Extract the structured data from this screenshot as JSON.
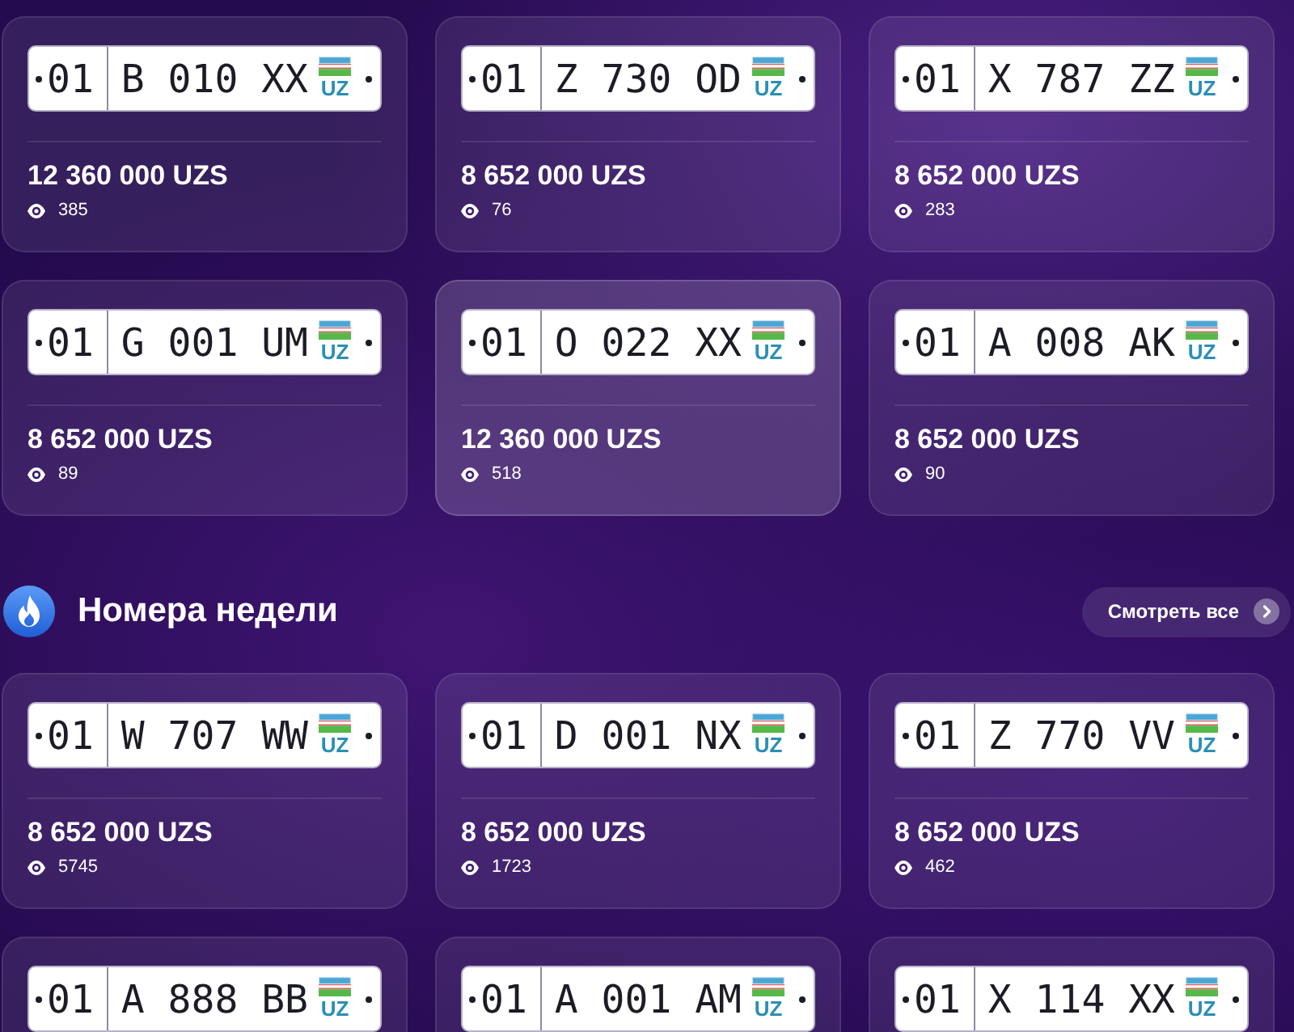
{
  "featured": {
    "cards": [
      {
        "plate": {
          "region": "01",
          "number": "B 010 XX",
          "country": "UZ"
        },
        "price": "12 360 000 UZS",
        "views": "385",
        "highlighted": false
      },
      {
        "plate": {
          "region": "01",
          "number": "Z 730 OD",
          "country": "UZ"
        },
        "price": "8 652 000 UZS",
        "views": "76",
        "highlighted": false
      },
      {
        "plate": {
          "region": "01",
          "number": "X 787 ZZ",
          "country": "UZ"
        },
        "price": "8 652 000 UZS",
        "views": "283",
        "highlighted": false
      },
      {
        "plate": {
          "region": "01",
          "number": "G 001 UM",
          "country": "UZ"
        },
        "price": "8 652 000 UZS",
        "views": "89",
        "highlighted": false
      },
      {
        "plate": {
          "region": "01",
          "number": "O 022 XX",
          "country": "UZ"
        },
        "price": "12 360 000 UZS",
        "views": "518",
        "highlighted": true
      },
      {
        "plate": {
          "region": "01",
          "number": "A 008 AK",
          "country": "UZ"
        },
        "price": "8 652 000 UZS",
        "views": "90",
        "highlighted": false
      }
    ]
  },
  "weekly": {
    "title": "Номера недели",
    "view_all": "Смотреть все",
    "cards": [
      {
        "plate": {
          "region": "01",
          "number": "W 707 WW",
          "country": "UZ"
        },
        "price": "8 652 000 UZS",
        "views": "5745",
        "highlighted": false
      },
      {
        "plate": {
          "region": "01",
          "number": "D 001 NX",
          "country": "UZ"
        },
        "price": "8 652 000 UZS",
        "views": "1723",
        "highlighted": false
      },
      {
        "plate": {
          "region": "01",
          "number": "Z 770 VV",
          "country": "UZ"
        },
        "price": "8 652 000 UZS",
        "views": "462",
        "highlighted": false
      },
      {
        "plate": {
          "region": "01",
          "number": "A 888 BB",
          "country": "UZ"
        },
        "highlighted": false
      },
      {
        "plate": {
          "region": "01",
          "number": "A 001 AM",
          "country": "UZ"
        },
        "highlighted": false
      },
      {
        "plate": {
          "region": "01",
          "number": "X 114 XX",
          "country": "UZ"
        },
        "highlighted": false
      }
    ]
  }
}
